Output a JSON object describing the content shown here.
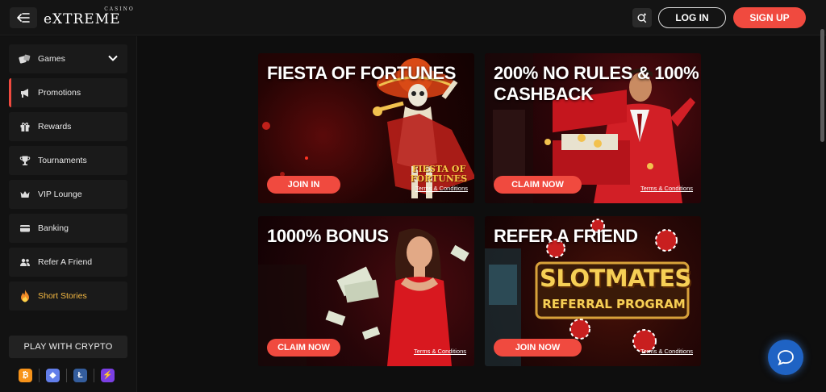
{
  "header": {
    "logo_small": "CASINO",
    "logo_main": "eXTREME",
    "login_label": "LOG IN",
    "signup_label": "SIGN UP"
  },
  "sidebar": {
    "items": [
      {
        "label": "Games",
        "icon": "dice-icon"
      },
      {
        "label": "Promotions",
        "icon": "megaphone-icon"
      },
      {
        "label": "Rewards",
        "icon": "gift-icon"
      },
      {
        "label": "Tournaments",
        "icon": "trophy-icon"
      },
      {
        "label": "VIP Lounge",
        "icon": "crown-icon"
      },
      {
        "label": "Banking",
        "icon": "card-icon"
      },
      {
        "label": "Refer A Friend",
        "icon": "users-icon"
      },
      {
        "label": "Short Stories",
        "icon": "flame-icon"
      }
    ],
    "crypto_label": "PLAY WITH CRYPTO",
    "coins": [
      {
        "symbol": "₿",
        "name": "bitcoin-icon",
        "color": "#f7931a"
      },
      {
        "symbol": "◆",
        "name": "ethereum-icon",
        "color": "#627eea"
      },
      {
        "symbol": "Ł",
        "name": "litecoin-icon",
        "color": "#345d9d"
      },
      {
        "symbol": "⚡",
        "name": "lightning-icon",
        "color": "#7b3fe4"
      }
    ]
  },
  "cards": [
    {
      "title": "FIESTA OF FORTUNES",
      "button": "JOIN IN",
      "terms": "Terms & Conditions",
      "art_text": "FIESTA OF FORTUNES"
    },
    {
      "title": "200% NO RULES & 100% CASHBACK",
      "button": "CLAIM NOW",
      "terms": "Terms & Conditions"
    },
    {
      "title": "1000% BONUS",
      "button": "CLAIM NOW",
      "terms": "Terms & Conditions"
    },
    {
      "title": "REFER A FRIEND",
      "button": "JOIN NOW",
      "terms": "Terms & Conditions",
      "art_text_1": "SLOTMATES",
      "art_text_2": "REFERRAL PROGRAM"
    }
  ],
  "colors": {
    "accent": "#f04a3f",
    "background": "#0e0e0e",
    "chat": "#1f63c4"
  }
}
